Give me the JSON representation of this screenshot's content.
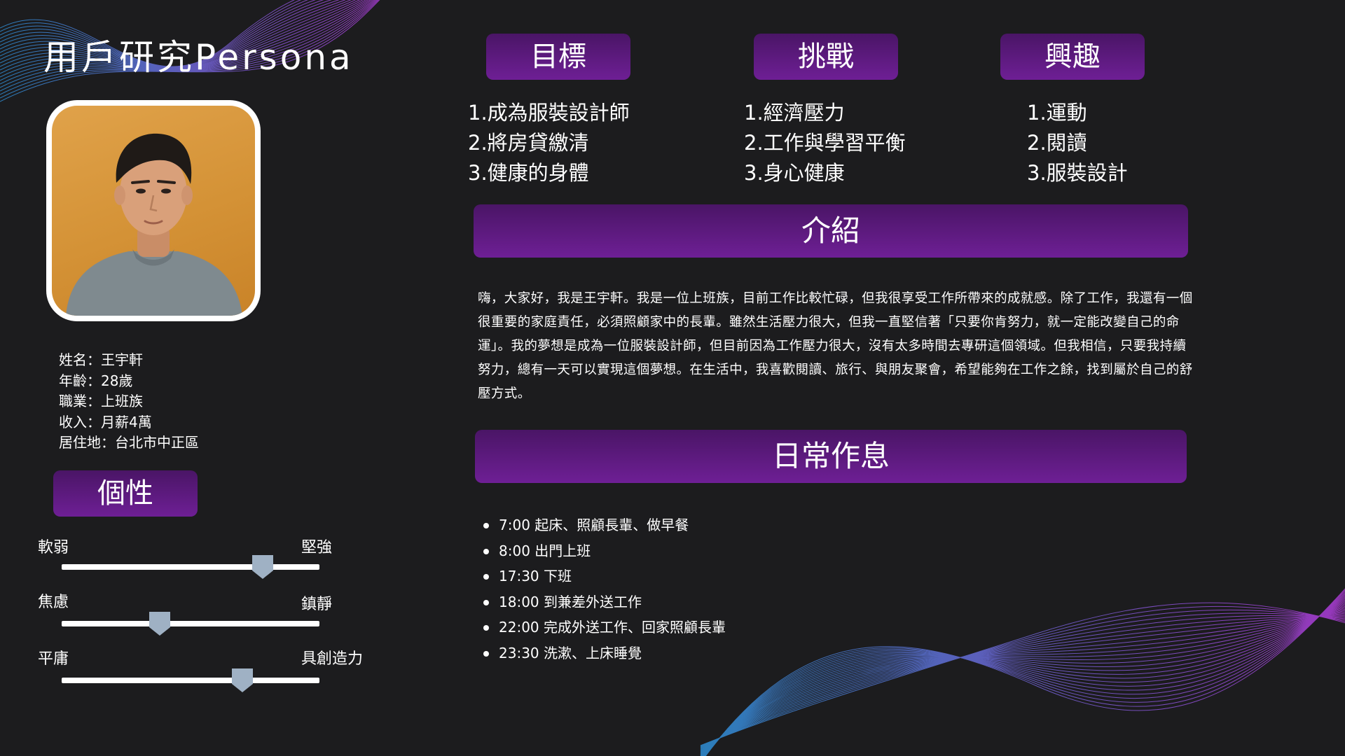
{
  "title": "用戶研究Persona",
  "profile": {
    "name": "姓名：王宇軒",
    "age": "年齡：28歲",
    "job": "職業：上班族",
    "income": "收入：月薪4萬",
    "residence": "居住地：台北市中正區"
  },
  "personality": {
    "heading": "個性",
    "sliders": [
      {
        "left": "軟弱",
        "right": "堅強",
        "value": 0.78
      },
      {
        "left": "焦慮",
        "right": "鎮靜",
        "value": 0.38
      },
      {
        "left": "平庸",
        "right": "具創造力",
        "value": 0.7
      }
    ]
  },
  "goals": {
    "heading": "目標",
    "items": [
      "1.成為服裝設計師",
      "2.將房貸繳清",
      "3.健康的身體"
    ]
  },
  "challenges": {
    "heading": "挑戰",
    "items": [
      "1.經濟壓力",
      "2.工作與學習平衡",
      "3.身心健康"
    ]
  },
  "interests": {
    "heading": "興趣",
    "items": [
      "1.運動",
      "2.閱讀",
      "3.服裝設計"
    ]
  },
  "introduction": {
    "heading": "介紹",
    "text": "嗨，大家好，我是王宇軒。我是一位上班族，目前工作比較忙碌，但我很享受工作所帶來的成就感。除了工作，我還有一個很重要的家庭責任，必須照顧家中的長輩。雖然生活壓力很大，但我一直堅信著「只要你肯努力，就一定能改變自己的命運」。我的夢想是成為一位服裝設計師，但目前因為工作壓力很大，沒有太多時間去專研這個領域。但我相信，只要我持續努力，總有一天可以實現這個夢想。在生活中，我喜歡閱讀、旅行、與朋友聚會，希望能夠在工作之餘，找到屬於自己的舒壓方式。"
  },
  "routine": {
    "heading": "日常作息",
    "items": [
      "7:00 起床、照顧長輩、做早餐",
      "8:00 出門上班",
      "17:30 下班",
      "18:00 到兼差外送工作",
      "22:00 完成外送工作、回家照顧長輩",
      "23:30 洗漱、上床睡覺"
    ]
  },
  "colors": {
    "background": "#1c1c1e",
    "pill_top": "#4a1566",
    "pill_bottom": "#6e1f95",
    "slider_knob": "#9fb1c4",
    "wave_start": "#2f8fd6",
    "wave_end": "#b03bd8"
  }
}
